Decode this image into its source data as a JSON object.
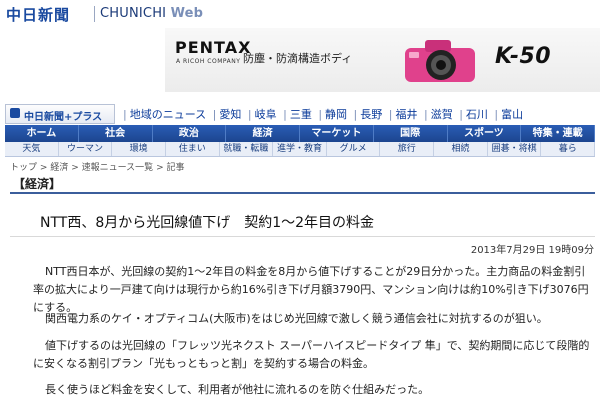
{
  "header": {
    "logo_jp": "中日新聞",
    "logo_en": "CHUNICHI",
    "logo_web": "Web"
  },
  "ad": {
    "brand": "PENTAX",
    "sub": "A RICOH COMPANY",
    "copy": "防塵・防滴構造ボディ",
    "model": "K-50"
  },
  "plus_logo": "中日新聞+プラス",
  "region_links": [
    "地域のニュース",
    "愛知",
    "岐阜",
    "三重",
    "静岡",
    "長野",
    "福井",
    "滋賀",
    "石川",
    "富山"
  ],
  "nav_main": [
    "ホーム",
    "社会",
    "政治",
    "経済",
    "マーケット",
    "国際",
    "スポーツ",
    "特集・連載"
  ],
  "nav_sub": [
    "天気",
    "ウーマン",
    "環境",
    "住まい",
    "就職・転職",
    "進学・教育",
    "グルメ",
    "旅行",
    "相続",
    "囲碁・将棋",
    "暮ら"
  ],
  "breadcrumb": {
    "home": "トップ",
    "sep": ">",
    "c1": "経済",
    "c2": "速報ニュース一覧",
    "current": "記事"
  },
  "section": "【経済】",
  "article": {
    "title": "NTT西、8月から光回線値下げ　契約1～2年目の料金",
    "date": "2013年7月29日 19時09分",
    "p1": "NTT西日本が、光回線の契約1～2年目の料金を8月から値下げすることが29日分かった。主力商品の料金割引率の拡大により一戸建て向けは現行から約16%引き下げ月額3790円、マンション向けは約10%引き下げ3076円にする。",
    "p2": "関西電力系のケイ・オプティコム(大阪市)をはじめ光回線で激しく競う通信会社に対抗するのが狙い。",
    "p3": "値下げするのは光回線の「フレッツ光ネクスト スーパーハイスピードタイプ 隼」で、契約期間に応じて段階的に安くなる割引プラン「光もっともっと割」を契約する場合の料金。",
    "p4": "長く使うほど料金を安くして、利用者が他社に流れるのを防ぐ仕組みだった。"
  }
}
